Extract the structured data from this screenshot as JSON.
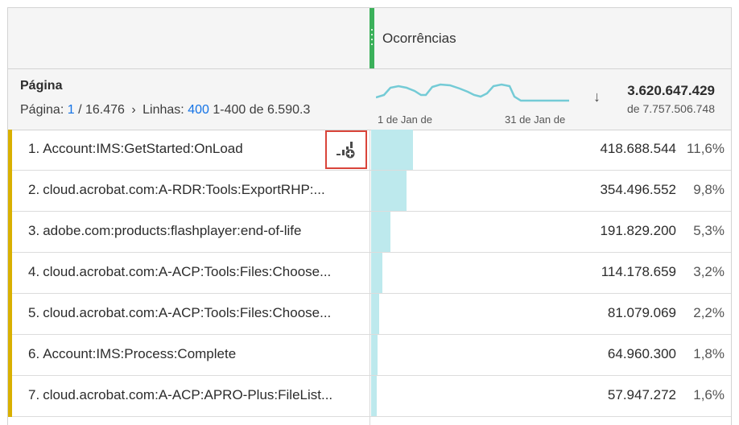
{
  "header": {
    "metric_title": "Ocorrências"
  },
  "summary": {
    "dimension_title": "Página",
    "pager": {
      "page_label": "Página:",
      "current_page": "1",
      "total_pages": "/ 16.476",
      "next_symbol": "›",
      "rows_label": "Linhas:",
      "rows_value": "400",
      "range_text": "1-400 de 6.590.3"
    },
    "sparkline": {
      "start_label": "1 de Jan de",
      "end_label": "31 de Jan de",
      "color": "#74cbd6"
    },
    "sort_arrow": "↓",
    "total_value": "3.620.647.429",
    "total_of": "de 7.757.506.748"
  },
  "rows": [
    {
      "num": "1.",
      "label": "Account:IMS:GetStarted:OnLoad",
      "value": "418.688.544",
      "pct": "11,6%",
      "share": 0.116
    },
    {
      "num": "2.",
      "label": "cloud.acrobat.com:A-RDR:Tools:ExportRHP:...",
      "value": "354.496.552",
      "pct": "9,8%",
      "share": 0.098
    },
    {
      "num": "3.",
      "label": "adobe.com:products:flashplayer:end-of-life",
      "value": "191.829.200",
      "pct": "5,3%",
      "share": 0.053
    },
    {
      "num": "4.",
      "label": "cloud.acrobat.com:A-ACP:Tools:Files:Choose...",
      "value": "114.178.659",
      "pct": "3,2%",
      "share": 0.032
    },
    {
      "num": "5.",
      "label": "cloud.acrobat.com:A-ACP:Tools:Files:Choose...",
      "value": "81.079.069",
      "pct": "2,2%",
      "share": 0.022
    },
    {
      "num": "6.",
      "label": "Account:IMS:Process:Complete",
      "value": "64.960.300",
      "pct": "1,8%",
      "share": 0.018
    },
    {
      "num": "7.",
      "label": "cloud.acrobat.com:A-ACP:APRO-Plus:FileList...",
      "value": "57.947.272",
      "pct": "1,6%",
      "share": 0.016
    }
  ],
  "colors": {
    "accent_row": "#d9b000",
    "metric_green": "#3bb05a",
    "bar_fill": "#bde9ed",
    "link_blue": "#1473e6",
    "highlight_red": "#d9443a"
  },
  "icons": {
    "breakdown": "breakdown-add-icon",
    "sort": "sort-descending-icon"
  }
}
